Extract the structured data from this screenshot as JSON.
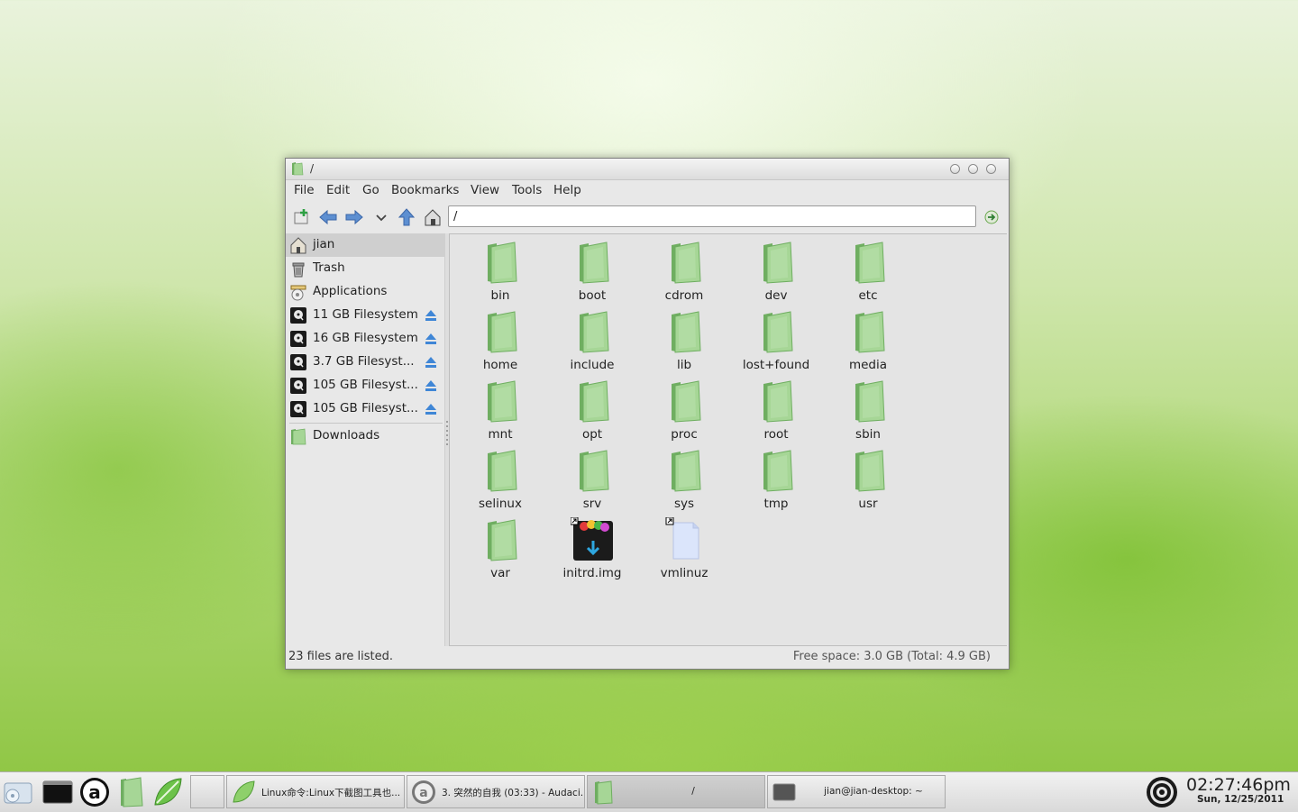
{
  "window": {
    "title": "/"
  },
  "menubar": {
    "items": [
      {
        "label": "File"
      },
      {
        "label": "Edit"
      },
      {
        "label": "Go"
      },
      {
        "label": "Bookmarks"
      },
      {
        "label": "View"
      },
      {
        "label": "Tools"
      },
      {
        "label": "Help"
      }
    ]
  },
  "toolbar": {
    "icons": [
      "new-tab-icon",
      "back-icon",
      "forward-icon",
      "history-dropdown-icon",
      "up-icon",
      "home-icon",
      "go-icon"
    ],
    "location_value": "/"
  },
  "sidebar": {
    "items": [
      {
        "label": "jian",
        "icon": "home-folder-icon"
      },
      {
        "label": "Trash",
        "icon": "trash-icon"
      },
      {
        "label": "Applications",
        "icon": "applications-icon"
      },
      {
        "label": "11 GB Filesystem",
        "icon": "drive-icon"
      },
      {
        "label": "16 GB Filesystem",
        "icon": "drive-icon"
      },
      {
        "label": "3.7 GB Filesyst...",
        "icon": "drive-icon"
      },
      {
        "label": "105 GB Filesyst...",
        "icon": "drive-icon"
      },
      {
        "label": "105 GB Filesyst...",
        "icon": "drive-icon"
      }
    ],
    "bookmarks": [
      {
        "label": "Downloads",
        "icon": "folder-icon"
      }
    ]
  },
  "files": {
    "items": [
      {
        "name": "bin"
      },
      {
        "name": "boot"
      },
      {
        "name": "cdrom"
      },
      {
        "name": "dev"
      },
      {
        "name": "etc"
      },
      {
        "name": "home"
      },
      {
        "name": "include"
      },
      {
        "name": "lib"
      },
      {
        "name": "lost+found"
      },
      {
        "name": "media"
      },
      {
        "name": "mnt"
      },
      {
        "name": "opt"
      },
      {
        "name": "proc"
      },
      {
        "name": "root"
      },
      {
        "name": "sbin"
      },
      {
        "name": "selinux"
      },
      {
        "name": "srv"
      },
      {
        "name": "sys"
      },
      {
        "name": "tmp"
      },
      {
        "name": "usr"
      },
      {
        "name": "var"
      },
      {
        "name": "initrd.img"
      },
      {
        "name": "vmlinuz"
      }
    ]
  },
  "status": {
    "left": "23 files are listed.",
    "right": "Free space: 3.0 GB (Total: 4.9 GB)"
  },
  "panel": {
    "tasks": [
      {
        "label": "Linux命令:Linux下截图工具也..."
      },
      {
        "label": "3. 突然的自我 (03:33) - Audaci..."
      },
      {
        "label": "/"
      },
      {
        "label": "jian@jian-desktop: ~"
      }
    ],
    "clock_time": "02:27:46pm",
    "clock_date": "Sun, 12/25/2011"
  },
  "colors": {
    "folder": "#9fd38f",
    "folder_dark": "#6fae61",
    "eject": "#3f86d6"
  }
}
